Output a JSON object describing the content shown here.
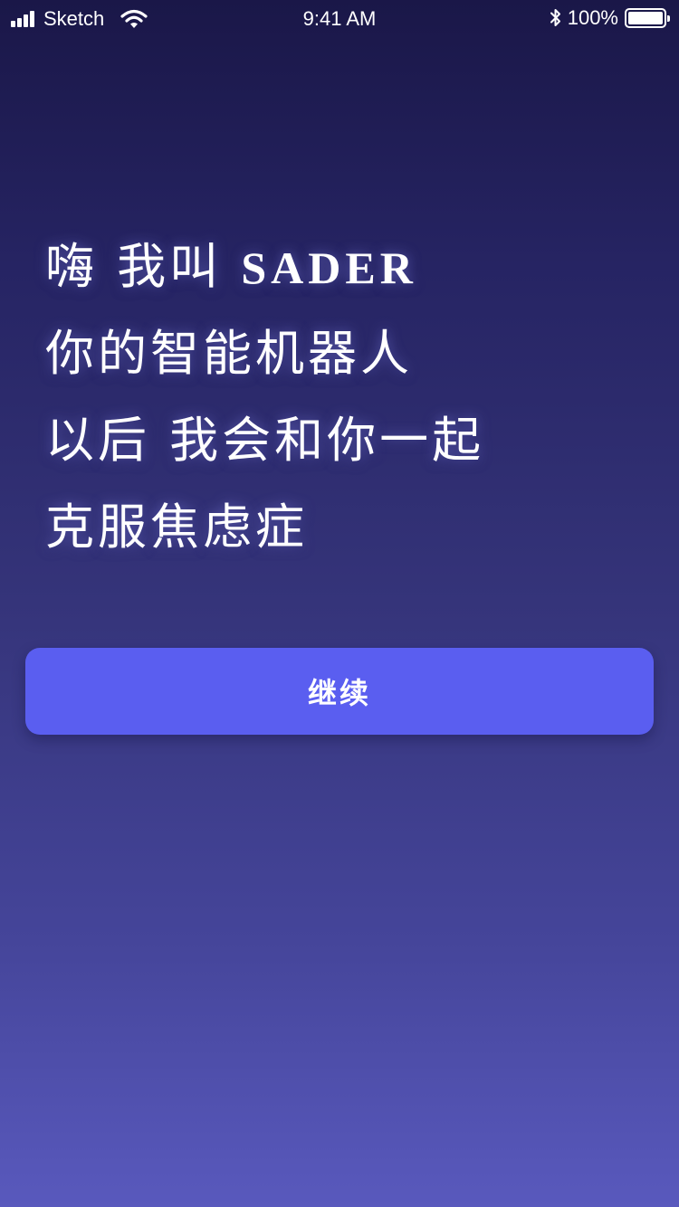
{
  "status_bar": {
    "carrier": "Sketch",
    "time": "9:41 AM",
    "battery_percent": "100%",
    "battery_level": 1.0,
    "icons": [
      "signal-icon",
      "wifi-icon",
      "bluetooth-icon",
      "battery-icon"
    ]
  },
  "greeting": {
    "line1_prefix": "嗨 我叫",
    "brand": "SADER",
    "line2": "你的智能机器人",
    "line3": "以后 我会和你一起",
    "line4": "克服焦虑症"
  },
  "actions": {
    "continue_label": "继续"
  },
  "colors": {
    "background_top": "#1a1748",
    "background_bottom": "#5959bd",
    "button": "#5a5ef0",
    "text": "#ffffff"
  }
}
